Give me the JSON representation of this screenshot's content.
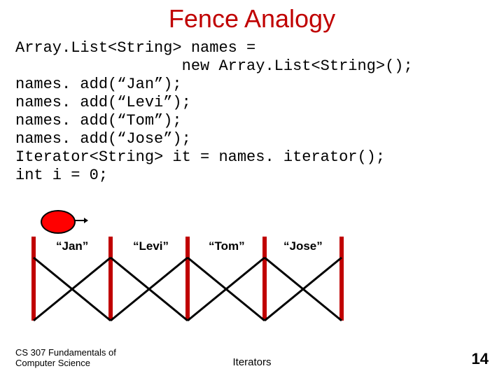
{
  "title": "Fence Analogy",
  "code": "Array.List<String> names =\n                  new Array.List<String>();\nnames. add(“Jan”);\nnames. add(“Levi”);\nnames. add(“Tom”);\nnames. add(“Jose”);\nIterator<String> it = names. iterator();\nint i = 0;",
  "fence": {
    "labels": [
      "“Jan”",
      "“Levi”",
      "“Tom”",
      "“Jose”"
    ],
    "post_color": "#c00000",
    "rail_color": "#000000"
  },
  "footer": {
    "left_line1": "CS 307 Fundamentals of",
    "left_line2": "Computer Science",
    "center": "Iterators",
    "page": "14"
  }
}
